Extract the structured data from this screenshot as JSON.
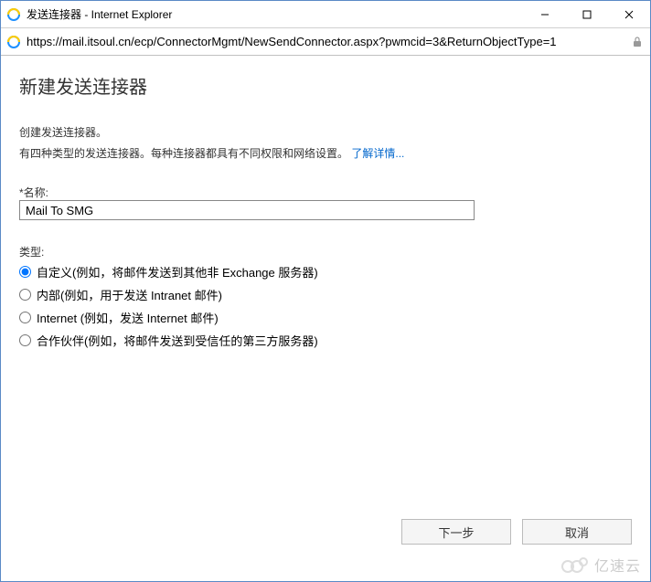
{
  "window": {
    "title": "发送连接器 - Internet Explorer"
  },
  "address": {
    "url": "https://mail.itsoul.cn/ecp/ConnectorMgmt/NewSendConnector.aspx?pwmcid=3&ReturnObjectType=1"
  },
  "page": {
    "heading": "新建发送连接器",
    "intro1": "创建发送连接器。",
    "intro2_prefix": "有四种类型的发送连接器。每种连接器都具有不同权限和网络设置。",
    "learn_more": "了解详情..."
  },
  "name_field": {
    "label": "*名称:",
    "value": "Mail To SMG"
  },
  "type_field": {
    "label": "类型:",
    "selected": "custom",
    "options": {
      "custom": "自定义(例如，将邮件发送到其他非 Exchange 服务器)",
      "internal": "内部(例如，用于发送 Intranet 邮件)",
      "internet": "Internet (例如，发送 Internet 邮件)",
      "partner": "合作伙伴(例如，将邮件发送到受信任的第三方服务器)"
    }
  },
  "buttons": {
    "next": "下一步",
    "cancel": "取消"
  },
  "watermark": {
    "text": "亿速云"
  }
}
